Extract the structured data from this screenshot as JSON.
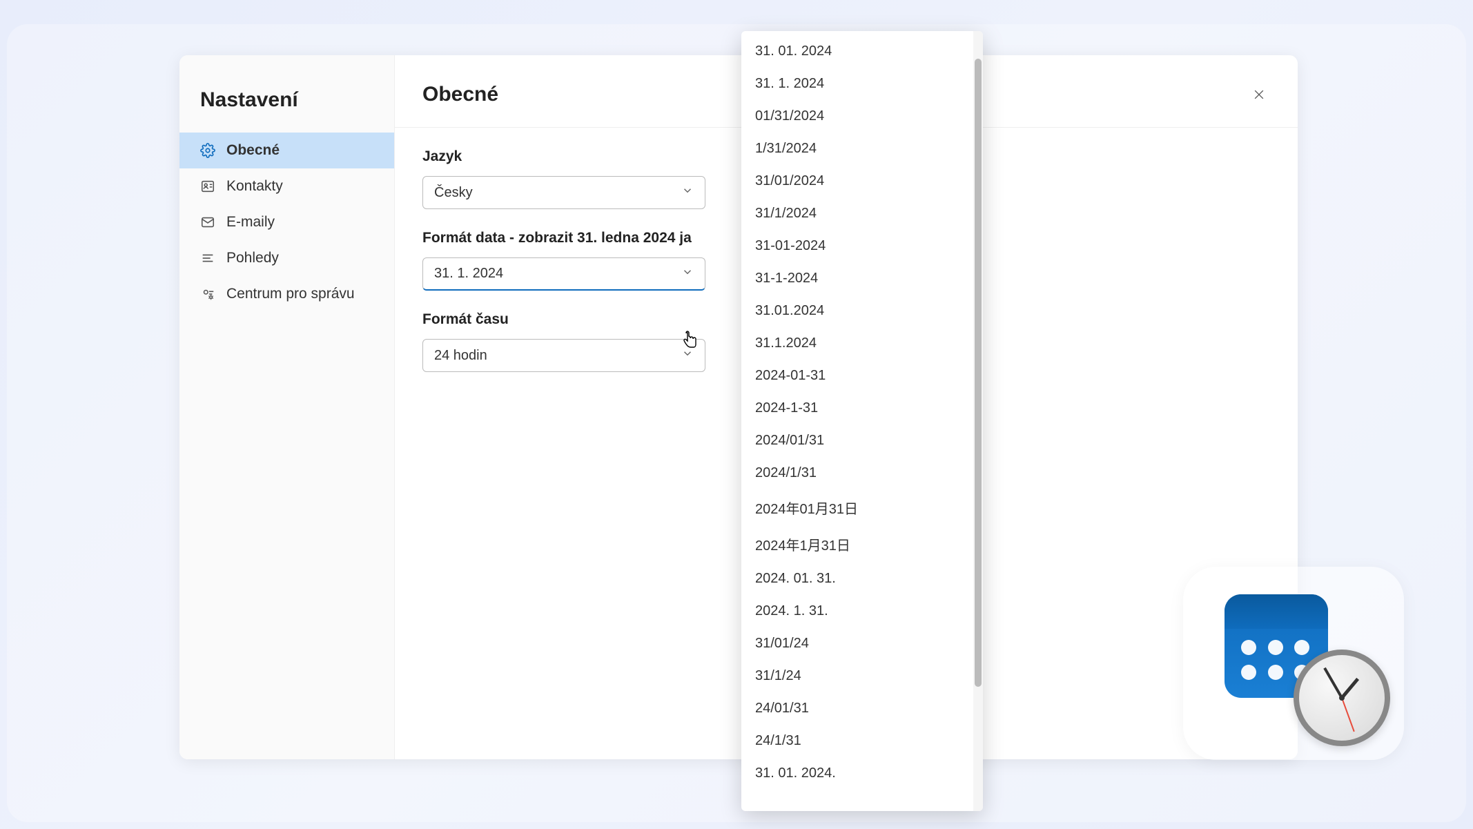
{
  "sidebar": {
    "title": "Nastavení",
    "items": [
      {
        "label": "Obecné",
        "active": true,
        "icon": "gear-icon"
      },
      {
        "label": "Kontakty",
        "active": false,
        "icon": "contact-icon"
      },
      {
        "label": "E-maily",
        "active": false,
        "icon": "mail-icon"
      },
      {
        "label": "Pohledy",
        "active": false,
        "icon": "list-icon"
      },
      {
        "label": "Centrum pro správu",
        "active": false,
        "icon": "admin-icon"
      }
    ]
  },
  "main": {
    "title": "Obecné",
    "language": {
      "label": "Jazyk",
      "value": "Česky"
    },
    "dateFormat": {
      "label": "Formát data - zobrazit 31. ledna 2024 ja",
      "value": "31. 1. 2024",
      "options": [
        "31. 01. 2024",
        "31. 1. 2024",
        "01/31/2024",
        "1/31/2024",
        "31/01/2024",
        "31/1/2024",
        "31-01-2024",
        "31-1-2024",
        "31.01.2024",
        "31.1.2024",
        "2024-01-31",
        "2024-1-31",
        "2024/01/31",
        "2024/1/31",
        "2024年01月31日",
        "2024年1月31日",
        "2024. 01. 31.",
        "2024. 1. 31.",
        "31/01/24",
        "31/1/24",
        "24/01/31",
        "24/1/31",
        "31. 01. 2024."
      ]
    },
    "timeFormat": {
      "label": "Formát času",
      "value": "24 hodin"
    }
  }
}
